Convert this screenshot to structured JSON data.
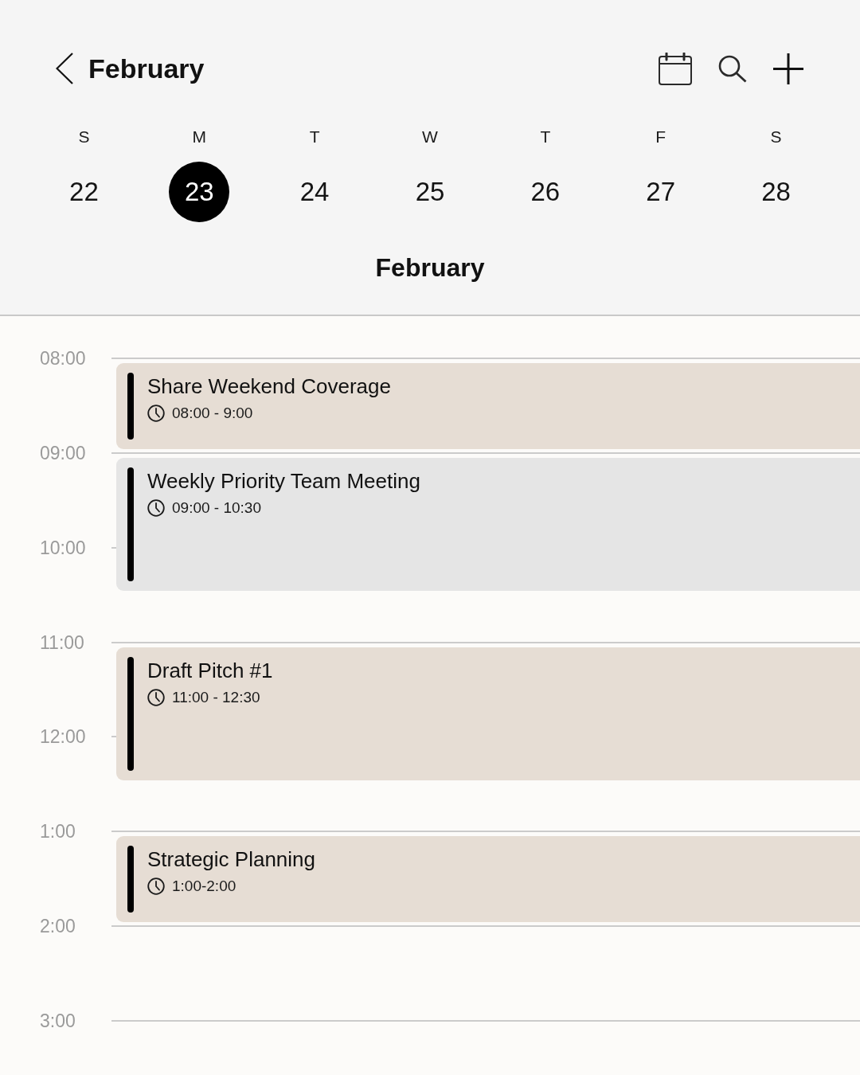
{
  "header": {
    "title": "February"
  },
  "week": {
    "days": [
      {
        "weekday": "S",
        "date": "22",
        "selected": false
      },
      {
        "weekday": "M",
        "date": "23",
        "selected": true
      },
      {
        "weekday": "T",
        "date": "24",
        "selected": false
      },
      {
        "weekday": "W",
        "date": "25",
        "selected": false
      },
      {
        "weekday": "T",
        "date": "26",
        "selected": false
      },
      {
        "weekday": "F",
        "date": "27",
        "selected": false
      },
      {
        "weekday": "S",
        "date": "28",
        "selected": false
      }
    ],
    "month": "February"
  },
  "timeline": {
    "hours": [
      {
        "label": "08:00",
        "events": [
          {
            "kind": "short",
            "title": "Share Weekend Coverage",
            "time": "08:00 - 9:00",
            "color": "#e6ddd4"
          }
        ]
      },
      {
        "label": "09:00",
        "events": [
          {
            "kind": "long",
            "title": "Weekly Priority Team Meeting",
            "time": "09:00 - 10:30",
            "color": "#e5e5e5"
          }
        ]
      },
      {
        "label": "10:00"
      },
      {
        "label": "11:00",
        "events": [
          {
            "kind": "long",
            "title": "Draft Pitch #1",
            "time": "11:00 - 12:30",
            "color": "#e6ddd4"
          }
        ]
      },
      {
        "label": "12:00"
      },
      {
        "label": "1:00",
        "events": [
          {
            "kind": "short",
            "title": "Strategic Planning",
            "time": "1:00-2:00",
            "color": "#e6ddd4"
          }
        ]
      },
      {
        "label": "2:00"
      },
      {
        "label": "3:00"
      }
    ]
  }
}
